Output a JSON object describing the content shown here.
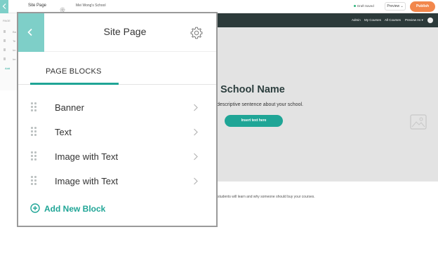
{
  "topbar": {
    "title": "Site Page",
    "school_name": "Mei Wong's School",
    "saved_status": "Draft Saved",
    "preview_label": "Preview ⌄",
    "publish_label": "Publish"
  },
  "background_sidebar": {
    "tab": "PAGE",
    "items": [
      "Ba",
      "Te",
      "Im",
      "Im"
    ],
    "add": "Add"
  },
  "site_nav": {
    "links": [
      "Admin",
      "My Courses",
      "All Courses",
      "Preview As ▾"
    ]
  },
  "hero": {
    "title": "School Name",
    "subtitle": "descriptive sentence about your school.",
    "button_label": "Insert text here",
    "body_text": "students will learn and why someone should buy your courses."
  },
  "panel": {
    "title": "Site Page",
    "tab_label": "PAGE BLOCKS",
    "blocks": [
      {
        "label": "Banner"
      },
      {
        "label": "Text"
      },
      {
        "label": "Image with Text"
      },
      {
        "label": "Image with Text"
      }
    ],
    "add_block_label": "Add New Block"
  },
  "colors": {
    "accent": "#1fa596",
    "panel_back": "#7ecfc8",
    "publish": "#f2874c",
    "site_nav": "#2c3a3a",
    "hero_bg": "#e3e3e3"
  },
  "icons": {
    "back": "chevron-left-icon",
    "settings": "gear-icon",
    "drag": "drag-handle-icon",
    "arrow": "chevron-right-icon",
    "add": "plus-circle-icon",
    "image": "image-placeholder-icon"
  }
}
